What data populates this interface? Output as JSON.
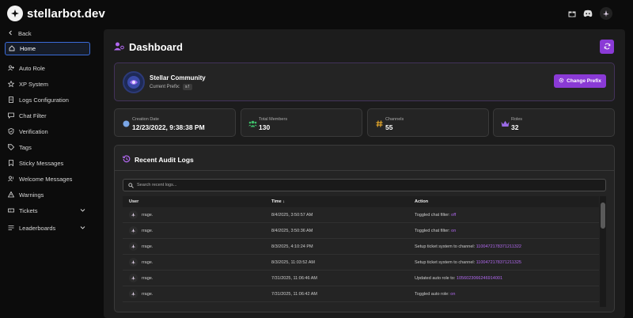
{
  "app": {
    "logo_text": "stellarbot.dev"
  },
  "colors": {
    "accent": "#8a3ad6",
    "link": "#b168f0",
    "active_border": "#3a6bd8"
  },
  "sidebar": {
    "items": [
      {
        "label": "Back",
        "icon": "chevron-left-icon"
      },
      {
        "label": "Home",
        "icon": "home-icon",
        "active": true
      },
      {
        "label": "Auto Role",
        "icon": "user-add-icon"
      },
      {
        "label": "XP System",
        "icon": "star-icon"
      },
      {
        "label": "Logs Configuration",
        "icon": "document-icon"
      },
      {
        "label": "Chat Filter",
        "icon": "chat-icon"
      },
      {
        "label": "Verification",
        "icon": "shield-check-icon"
      },
      {
        "label": "Tags",
        "icon": "tag-icon"
      },
      {
        "label": "Sticky Messages",
        "icon": "bookmark-icon"
      },
      {
        "label": "Welcome Messages",
        "icon": "user-wave-icon"
      },
      {
        "label": "Warnings",
        "icon": "warning-icon"
      },
      {
        "label": "Tickets",
        "icon": "ticket-icon",
        "expandable": true
      },
      {
        "label": "Leaderboards",
        "icon": "list-icon",
        "expandable": true
      }
    ]
  },
  "main": {
    "title": "Dashboard",
    "server": {
      "name": "Stellar Community",
      "prefix_label": "Current Prefix:",
      "prefix_value": "s!",
      "change_prefix_label": "Change Prefix"
    },
    "stats": [
      {
        "label": "Creation Date",
        "value": "12/23/2022, 9:38:38 PM",
        "icon": "globe-icon",
        "color": "#7aa6e6"
      },
      {
        "label": "Total Members",
        "value": "130",
        "icon": "users-icon",
        "color": "#3fbf6a"
      },
      {
        "label": "Channels",
        "value": "55",
        "icon": "hash-icon",
        "color": "#e0a52a"
      },
      {
        "label": "Roles",
        "value": "32",
        "icon": "crown-icon",
        "color": "#9a6ae6"
      }
    ],
    "audit": {
      "title": "Recent Audit Logs",
      "search_placeholder": "Search recent logs...",
      "columns": {
        "user": "User",
        "time": "Time ↓",
        "action": "Action"
      },
      "rows": [
        {
          "user": "rrage.",
          "time": "8/4/2025, 3:50:57 AM",
          "action": "Toggled chat filter: ",
          "highlight": "off"
        },
        {
          "user": "rrage.",
          "time": "8/4/2025, 3:50:36 AM",
          "action": "Toggled chat filter: ",
          "highlight": "on"
        },
        {
          "user": "rrage.",
          "time": "8/3/2025, 4:10:24 PM",
          "action": "Setup ticket system to channel: ",
          "highlight": "1100472178371211322"
        },
        {
          "user": "rrage.",
          "time": "8/3/2025, 11:03:52 AM",
          "action": "Setup ticket system to channel: ",
          "highlight": "1100472178371211325"
        },
        {
          "user": "rrage.",
          "time": "7/31/2025, 11:06:46 AM",
          "action": "Updated auto role to: ",
          "highlight": "1056023066246914001"
        },
        {
          "user": "rrage.",
          "time": "7/31/2025, 11:06:42 AM",
          "action": "Toggled auto role: ",
          "highlight": "on"
        }
      ]
    }
  }
}
